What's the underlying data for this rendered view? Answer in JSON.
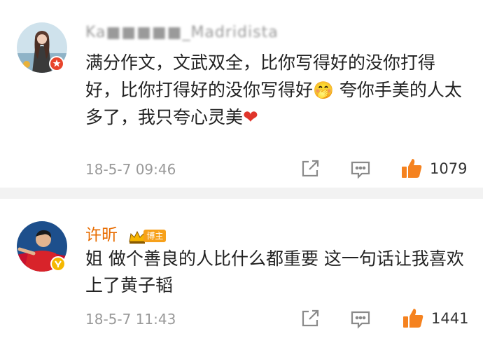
{
  "comments": [
    {
      "username": "Ka■■■■■_Madridista",
      "text": "满分作文，文武双全，比你写得好的没你打得好，比你打得好的没你写得好",
      "emoji": "🤭",
      "text_after_emoji": " 夸你手美的人太多了，我只夸心灵美",
      "heart": "❤",
      "time": "18-5-7 09:46",
      "likes": "1079"
    },
    {
      "username": "许昕",
      "badge_label": "博主",
      "text": "姐 做个善良的人比什么都重要 这一句话让我喜欢上了黄子韬",
      "time": "18-5-7 11:43",
      "likes": "1441"
    }
  ],
  "colors": {
    "username_highlight": "#e86c00",
    "like_orange": "#f5821f",
    "meta_gray": "#999999",
    "heart_red": "#e0352b",
    "divider": "#f2f2f2"
  },
  "icons": [
    "share-icon",
    "comment-icon",
    "like-icon",
    "verified-icon"
  ]
}
